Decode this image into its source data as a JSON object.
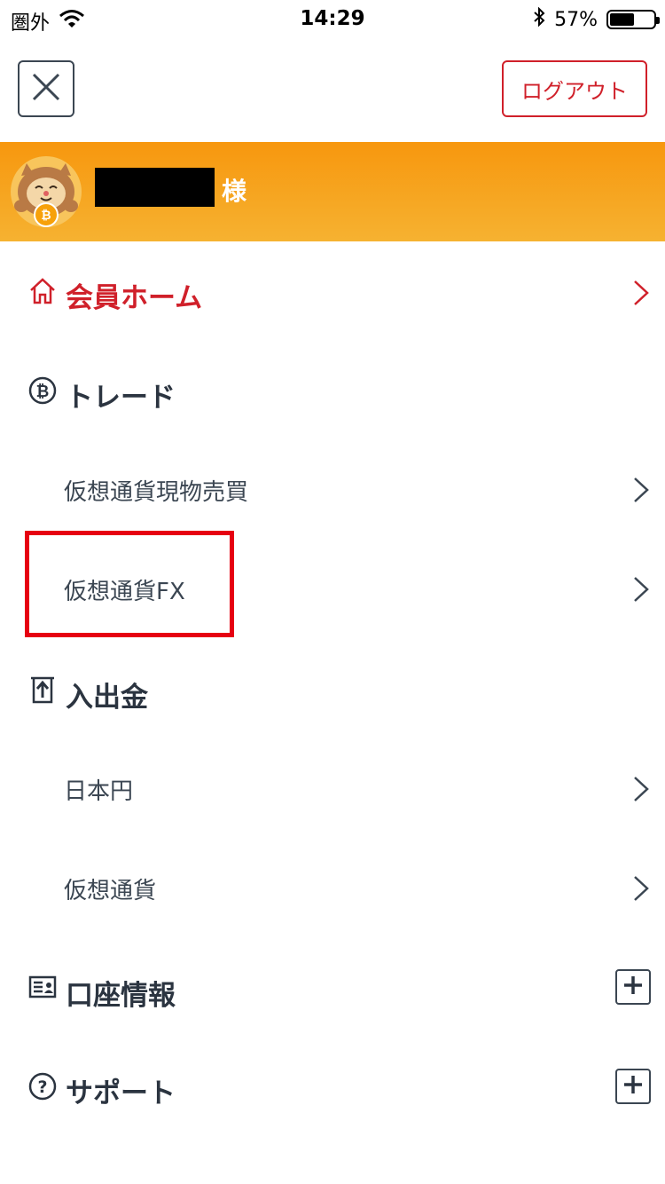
{
  "status_bar": {
    "carrier": "圏外",
    "time": "14:29",
    "battery": "57%",
    "battery_level": 0.57
  },
  "header": {
    "close_icon": "close-icon",
    "logout_label": "ログアウト"
  },
  "user": {
    "honorific": "様",
    "avatar_icon": "bitcoin-cat-avatar"
  },
  "menu": {
    "home": {
      "label": "会員ホーム",
      "icon": "home-icon",
      "color": "#d0202a"
    },
    "trade": {
      "label": "トレード",
      "icon": "bitcoin-icon",
      "items": [
        {
          "label": "仮想通貨現物売買"
        },
        {
          "label": "仮想通貨FX"
        }
      ]
    },
    "deposit": {
      "label": "入出金",
      "icon": "transfer-icon",
      "items": [
        {
          "label": "日本円"
        },
        {
          "label": "仮想通貨"
        }
      ]
    },
    "account": {
      "label": "口座情報",
      "icon": "id-card-icon"
    },
    "support": {
      "label": "サポート",
      "icon": "question-icon"
    }
  },
  "colors": {
    "accent_red": "#d0202a",
    "banner_orange": "#f7970e",
    "highlight": "#e60012",
    "text": "#2b3440"
  }
}
